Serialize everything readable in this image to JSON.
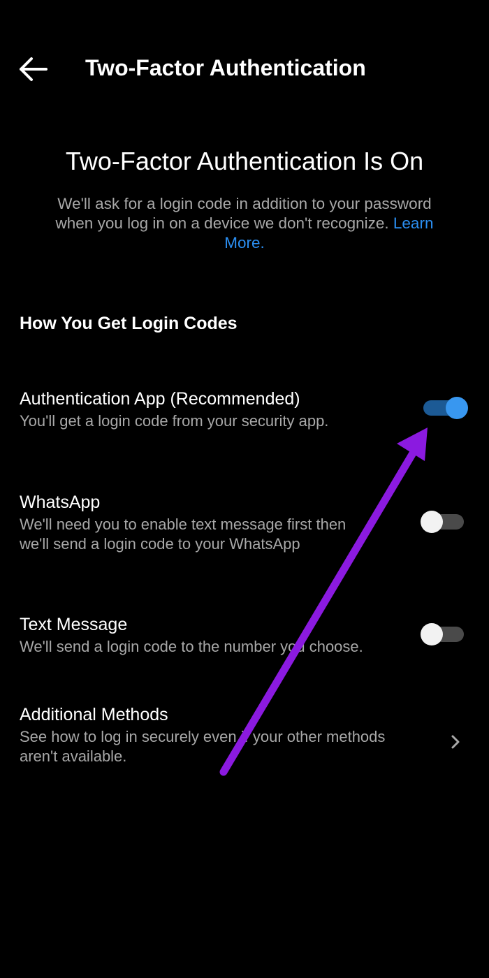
{
  "header": {
    "title": "Two-Factor Authentication",
    "back_icon": "arrow-left-icon"
  },
  "status": {
    "title": "Two-Factor Authentication Is On",
    "description": "We'll ask for a login code in addition to your password when you log in on a device we don't recognize.",
    "learn_more": "Learn More."
  },
  "section": {
    "heading": "How You Get Login Codes"
  },
  "options": [
    {
      "title": "Authentication App (Recommended)",
      "description": "You'll get a login code from your security app.",
      "enabled": true
    },
    {
      "title": "WhatsApp",
      "description": "We'll need you to enable text message first then we'll send a login code to your WhatsApp",
      "enabled": false
    },
    {
      "title": "Text Message",
      "description": "We'll send a login code to the number you choose.",
      "enabled": false
    }
  ],
  "additional": {
    "title": "Additional Methods",
    "description": "See how to log in securely even if your other methods aren't available.",
    "icon": "chevron-right-icon"
  },
  "colors": {
    "background": "#000000",
    "accent": "#3897f0",
    "link": "#2b8ff2",
    "secondary_text": "#a8a8a8",
    "annotation": "#8b1ae0"
  }
}
